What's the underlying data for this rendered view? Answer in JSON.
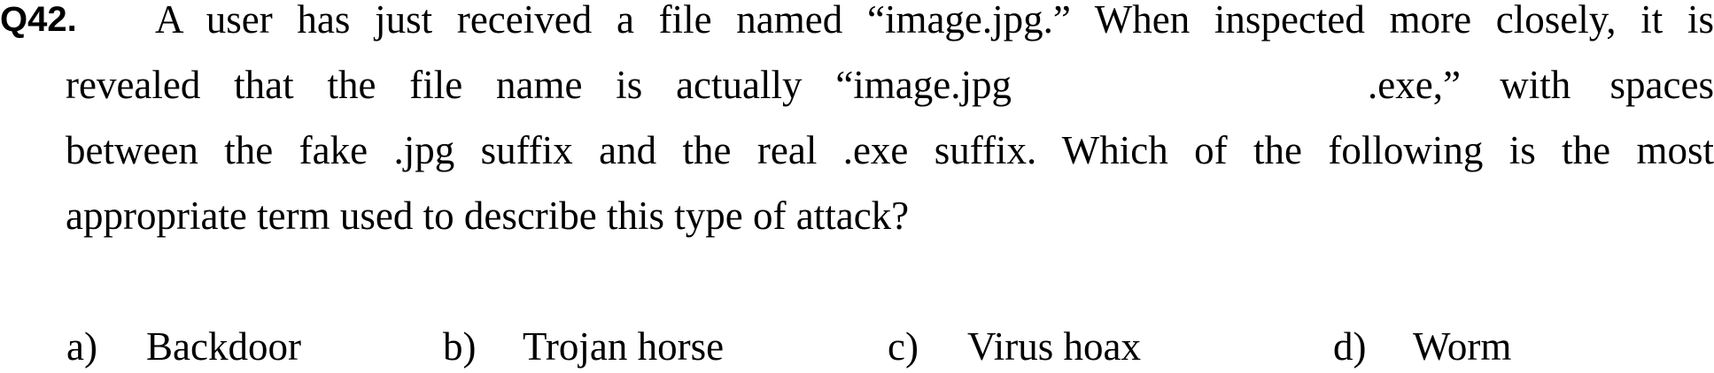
{
  "question": {
    "number": "Q42.",
    "line1": "A user has just received a file named “image.jpg.” When inspected more closely, it is",
    "line2a": "revealed that the file name is actually “image.jpg",
    "line2b": ".exe,” with spaces",
    "line3": "between the fake .jpg suffix and the real .exe suffix. Which of the following is the most",
    "line4": "appropriate term used to describe this type of attack?"
  },
  "options": [
    {
      "letter": "a)",
      "text": "Backdoor"
    },
    {
      "letter": "b)",
      "text": "Trojan horse"
    },
    {
      "letter": "c)",
      "text": "Virus hoax"
    },
    {
      "letter": "d)",
      "text": "Worm"
    }
  ]
}
